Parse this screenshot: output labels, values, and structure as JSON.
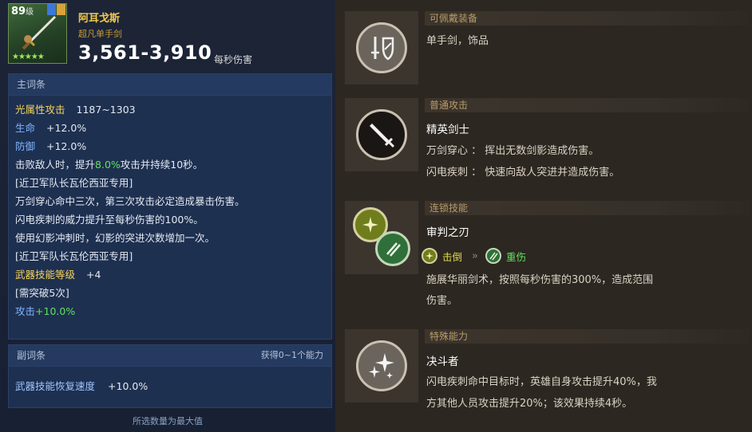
{
  "item": {
    "level": "89",
    "level_unit": "级",
    "name": "阿耳戈斯",
    "subtitle": "超凡单手剑",
    "stars": "★★★★★",
    "dps": "3,561-3,910",
    "dps_unit": "每秒伤害"
  },
  "main_stats": {
    "header": "主词条",
    "lines": [
      {
        "key": "光属性攻击",
        "value": "1187~1303"
      },
      {
        "key": "生命",
        "value": "+12.0%"
      },
      {
        "key": "防御",
        "value": "+12.0%"
      }
    ],
    "effect1_pre": "击败敌人时，提升",
    "effect1_val": "8.0%",
    "effect1_post": "攻击并持续10秒。",
    "exclusive1": "[近卫军队长瓦伦西亚专用]",
    "effect2": "万剑穿心命中三次，第三次攻击必定造成暴击伤害。",
    "effect3": "闪电疾刺的威力提升至每秒伤害的100%。",
    "effect4": "使用幻影冲刺时，幻影的突进次数增加一次。",
    "exclusive2": "[近卫军队长瓦伦西亚专用]",
    "skill_level_label": "武器技能等级",
    "skill_level_value": "+4",
    "breakthrough": "[需突破5次]",
    "attack_label": "攻击",
    "attack_value": "+10.0%"
  },
  "sub_stats": {
    "header": "副词条",
    "header_right": "获得0~1个能力",
    "key": "武器技能恢复速度",
    "value": "+10.0%"
  },
  "footer_note": "所选数量为最大值",
  "sections": {
    "equip": {
      "label": "可佩戴装备",
      "text": "单手剑，饰品"
    },
    "normal_attack": {
      "label": "普通攻击",
      "title": "精英剑士",
      "desc1": "万剑穿心 ： 挥出无数剑影造成伤害。",
      "desc2": "闪电疾刺 ： 快速向敌人突进并造成伤害。"
    },
    "chain": {
      "label": "连锁技能",
      "title": "审判之刃",
      "tag1": "击倒",
      "tag2": "重伤",
      "arrows": "»",
      "desc1": "施展华丽剑术，按照每秒伤害的300%，造成范围",
      "desc2": "伤害。"
    },
    "special": {
      "label": "特殊能力",
      "title": "决斗者",
      "desc1": "闪电疾刺命中目标时，英雄自身攻击提升40%，我",
      "desc2": "方其他人员攻击提升20%；该效果持续4秒。"
    }
  }
}
